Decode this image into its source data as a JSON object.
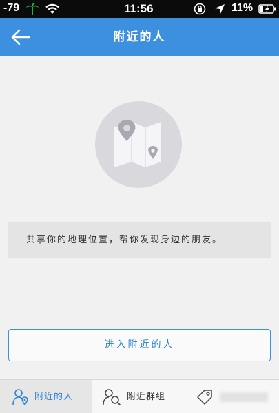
{
  "status_bar": {
    "signal": "-79",
    "time": "11:56",
    "battery": "11%"
  },
  "nav": {
    "title": "附近的人"
  },
  "content": {
    "description": "共享你的地理位置，帮你发现身边的朋友。",
    "enter_button": "进入附近的人"
  },
  "tabs": [
    {
      "label": "附近的人",
      "icon": "person-pin-icon",
      "selected": true
    },
    {
      "label": "附近群组",
      "icon": "group-search-icon",
      "selected": false
    },
    {
      "label": "",
      "icon": "tag-icon",
      "selected": false
    }
  ],
  "colors": {
    "accent": "#3d8fe0",
    "background": "#f1f1f1",
    "info_box": "#e4e4e4",
    "status_bar": "#0b0b0b"
  }
}
